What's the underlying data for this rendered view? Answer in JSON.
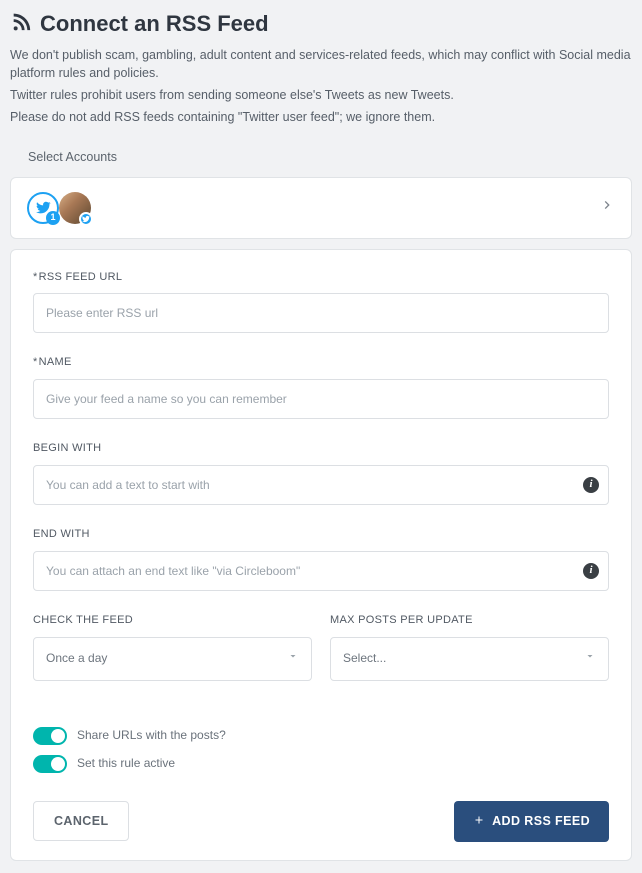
{
  "header": {
    "title": "Connect an RSS Feed",
    "icon": "rss-icon",
    "notices": [
      "We don't publish scam, gambling, adult content and services-related feeds, which may conflict with Social media platform rules and policies.",
      "Twitter rules prohibit users from sending someone else's Tweets as new Tweets.",
      "Please do not add RSS feeds containing \"Twitter user feed\"; we ignore them."
    ]
  },
  "accounts": {
    "section_label": "Select Accounts",
    "twitter_badge_count": "1"
  },
  "form": {
    "rss": {
      "label": "RSS FEED URL",
      "placeholder": "Please enter RSS url",
      "value": ""
    },
    "name": {
      "label": "NAME",
      "placeholder": "Give your feed a name so you can remember",
      "value": ""
    },
    "begin": {
      "label": "BEGIN WITH",
      "placeholder": "You can add a text to start with",
      "value": ""
    },
    "end": {
      "label": "END WITH",
      "placeholder": "You can attach an end text like \"via Circleboom\"",
      "value": ""
    },
    "check": {
      "label": "CHECK THE FEED",
      "value": "Once a day"
    },
    "max": {
      "label": "MAX POSTS PER UPDATE",
      "value": "Select..."
    }
  },
  "toggles": {
    "share_urls": {
      "label": "Share URLs with the posts?",
      "on": true
    },
    "active": {
      "label": "Set this rule active",
      "on": true
    }
  },
  "actions": {
    "cancel": "CANCEL",
    "submit": "ADD RSS FEED"
  }
}
